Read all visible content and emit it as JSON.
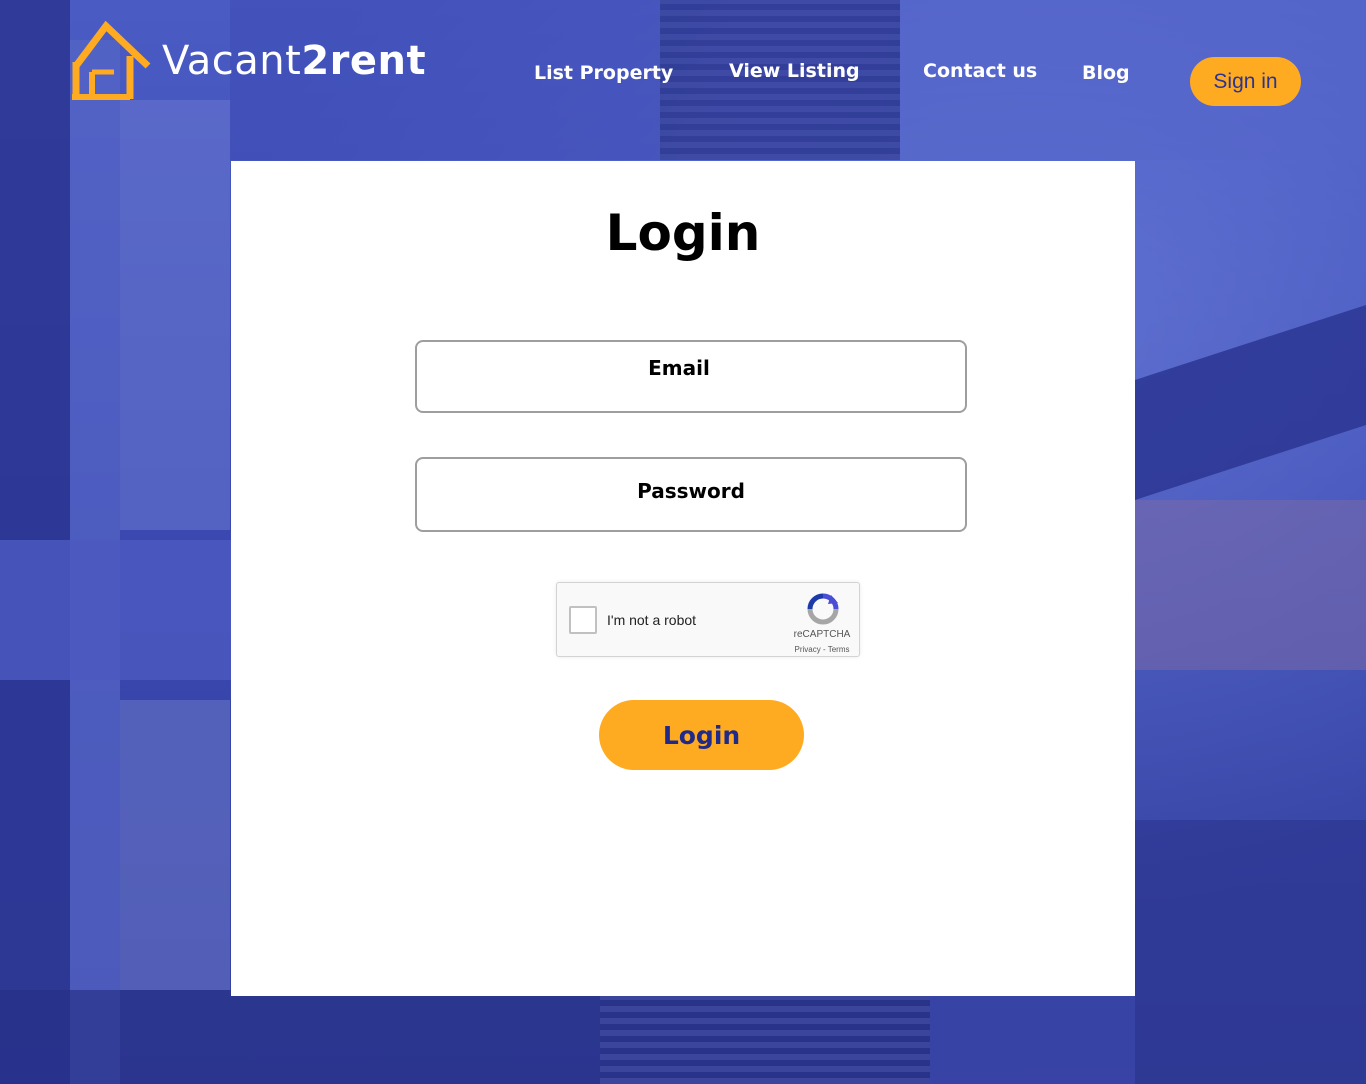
{
  "brand": {
    "name_light": "Vacant",
    "name_bold": "2rent",
    "accent_color": "#ffab21",
    "primary_color": "#2a3592"
  },
  "nav": {
    "items": [
      {
        "label": "List Property"
      },
      {
        "label": "View Listing"
      },
      {
        "label": "Contact us"
      },
      {
        "label": "Blog"
      }
    ],
    "signin_label": "Sign in"
  },
  "login": {
    "title": "Login",
    "email_label": "Email",
    "password_label": "Password",
    "submit_label": "Login"
  },
  "captcha": {
    "label": "I'm not a robot",
    "brand": "reCAPTCHA",
    "links": "Privacy - Terms",
    "checked": false
  },
  "icons": {
    "logo": "house-icon",
    "captcha": "recaptcha-icon"
  }
}
